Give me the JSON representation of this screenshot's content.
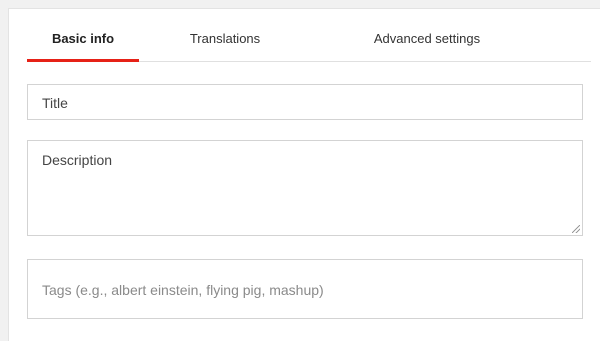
{
  "tabs": {
    "basic_info": "Basic info",
    "translations": "Translations",
    "advanced_settings": "Advanced settings",
    "active": "basic_info"
  },
  "form": {
    "title_placeholder": "Title",
    "description_placeholder": "Description",
    "tags_placeholder": "Tags (e.g., albert einstein, flying pig, mashup)"
  },
  "colors": {
    "accent": "#e62117"
  }
}
